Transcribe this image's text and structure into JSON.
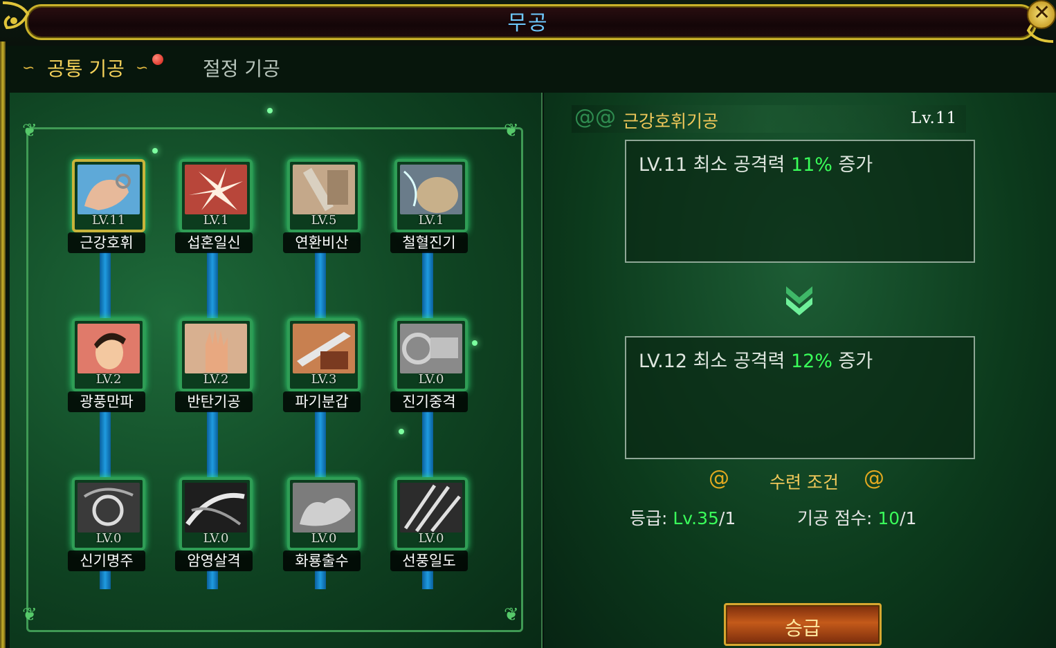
{
  "window": {
    "title": "무공",
    "close_label": "✕"
  },
  "tabs": [
    {
      "label": "공통 기공",
      "active": true,
      "has_notification": true
    },
    {
      "label": "절정 기공",
      "active": false
    }
  ],
  "skills": [
    {
      "name": "근강호휘",
      "level": "LV.11",
      "icon": "hand-grip-icon"
    },
    {
      "name": "섭혼일신",
      "level": "LV.1",
      "icon": "burst-strike-icon"
    },
    {
      "name": "연환비산",
      "level": "LV.5",
      "icon": "armored-sword-icon"
    },
    {
      "name": "철혈진기",
      "level": "LV.1",
      "icon": "iron-body-icon"
    },
    {
      "name": "광풍만파",
      "level": "LV.2",
      "icon": "warrior-face-icon"
    },
    {
      "name": "반탄기공",
      "level": "LV.2",
      "icon": "open-palm-icon"
    },
    {
      "name": "파기분갑",
      "level": "LV.3",
      "icon": "blade-break-icon"
    },
    {
      "name": "진기중격",
      "level": "LV.0",
      "icon": "heavy-strike-icon"
    },
    {
      "name": "신기명주",
      "level": "LV.0",
      "icon": "divine-orb-icon"
    },
    {
      "name": "암영살격",
      "level": "LV.0",
      "icon": "shadow-slash-icon"
    },
    {
      "name": "화룡출수",
      "level": "LV.0",
      "icon": "fire-dragon-icon"
    },
    {
      "name": "선풍일도",
      "level": "LV.0",
      "icon": "whirlwind-blade-icon"
    }
  ],
  "detail": {
    "skill_name": "근강호휘기공",
    "level": "Lv.11",
    "current": {
      "prefix": "LV.11 최소 공격력 ",
      "value": "11%",
      "suffix": " 증가"
    },
    "next": {
      "prefix": "LV.12 최소 공격력 ",
      "value": "12%",
      "suffix": " 증가"
    },
    "requirements": {
      "title": "수련 조건",
      "grade_label": "등급: ",
      "grade_value": "Lv.35",
      "grade_max": "/1",
      "points_label": "기공 점수: ",
      "points_value": "10",
      "points_max": "/1"
    },
    "upgrade_label": "승급"
  },
  "colors": {
    "accent_gold": "#f0c85a",
    "highlight_green": "#3aff5a",
    "title_blue": "#6ec9ff",
    "connector_blue": "#1f9be0"
  }
}
